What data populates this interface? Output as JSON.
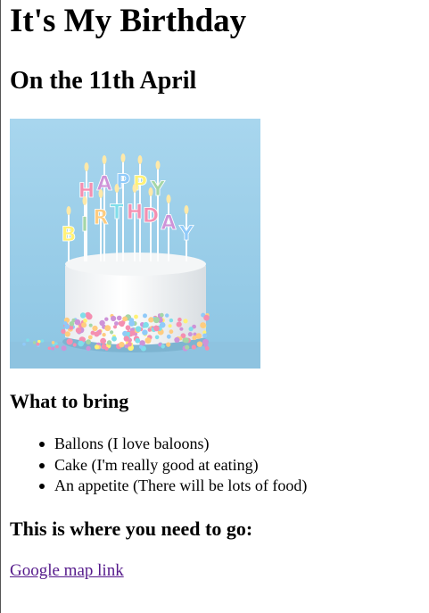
{
  "page": {
    "title": "It's My Birthday",
    "subtitle": "On the 11th April"
  },
  "image": {
    "alt": "Birthday cake with HAPPY BIRTHDAY candles",
    "candle_letters_top": [
      "H",
      "A",
      "P",
      "P",
      "Y"
    ],
    "candle_letters_bottom": [
      "B",
      "I",
      "R",
      "T",
      "H",
      "D",
      "A",
      "Y"
    ]
  },
  "bring": {
    "heading": "What to bring",
    "items": [
      {
        "text": "Ballons (I love baloons)"
      },
      {
        "text": "Cake (I'm really good at eating)"
      },
      {
        "text": "An appetite (There will be lots of food)"
      }
    ]
  },
  "location": {
    "heading": "This is where you need to go:",
    "link_text": "Google map link"
  },
  "colors": {
    "link_visited": "#551a8b",
    "image_bg": "#9fd0ea"
  }
}
